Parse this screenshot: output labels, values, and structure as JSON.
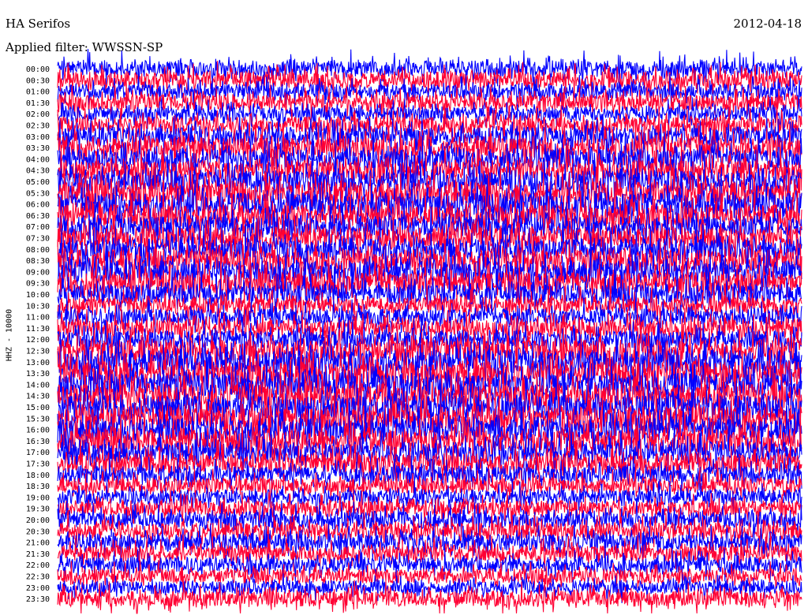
{
  "header": {
    "station": "HA Serifos",
    "date": "2012-04-18",
    "filter_label": "Applied filter:",
    "filter_value": "WWSSN-SP"
  },
  "colors": {
    "trace_a": "#0000ff",
    "trace_b": "#ff0033",
    "background": "#ffffff",
    "text": "#000000"
  },
  "chart_data": {
    "type": "line",
    "title": "HA Serifos",
    "ylabel": "HHZ - 10000",
    "xlabel": "",
    "grid": false,
    "trace_colors_alternating": [
      "#0000ff",
      "#ff0033"
    ],
    "row_labels": [
      "00:00",
      "00:30",
      "01:00",
      "01:30",
      "02:00",
      "02:30",
      "03:00",
      "03:30",
      "04:00",
      "04:30",
      "05:00",
      "05:30",
      "06:00",
      "06:30",
      "07:00",
      "07:30",
      "08:00",
      "08:30",
      "09:00",
      "09:30",
      "10:00",
      "10:30",
      "11:00",
      "11:30",
      "12:00",
      "12:30",
      "13:00",
      "13:30",
      "14:00",
      "14:30",
      "15:00",
      "15:30",
      "16:00",
      "16:30",
      "17:00",
      "17:30",
      "18:00",
      "18:30",
      "19:00",
      "19:30",
      "20:00",
      "20:30",
      "21:00",
      "21:30",
      "22:00",
      "22:30",
      "23:00",
      "23:30"
    ],
    "relative_activity": [
      0.55,
      0.6,
      0.5,
      0.55,
      0.45,
      0.6,
      0.75,
      0.85,
      0.8,
      0.85,
      0.95,
      1.0,
      1.0,
      0.95,
      0.85,
      0.85,
      0.9,
      0.95,
      0.95,
      0.9,
      0.8,
      0.55,
      0.55,
      0.6,
      0.65,
      0.95,
      1.05,
      1.05,
      1.05,
      1.05,
      1.05,
      1.05,
      1.0,
      1.0,
      0.85,
      0.75,
      0.6,
      0.5,
      0.5,
      0.55,
      0.55,
      0.6,
      0.6,
      0.55,
      0.5,
      0.45,
      0.4,
      0.55
    ]
  }
}
